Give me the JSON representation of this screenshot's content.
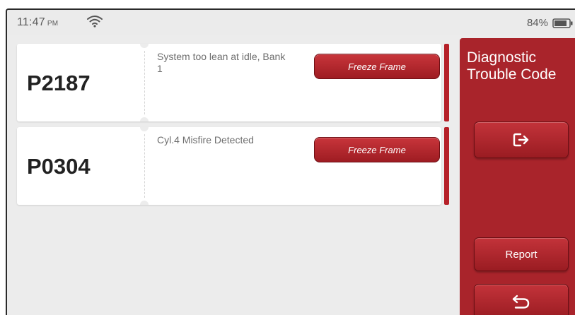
{
  "status_bar": {
    "time": "11:47",
    "ampm": "PM",
    "battery_percent": "84%",
    "icons": [
      "wifi-icon",
      "battery-icon"
    ]
  },
  "dtc_list": [
    {
      "code": "P2187",
      "description": "System too lean at idle, Bank 1",
      "button_label": "Freeze Frame"
    },
    {
      "code": "P0304",
      "description": "Cyl.4 Misfire Detected",
      "button_label": "Freeze Frame"
    }
  ],
  "side_panel": {
    "title": "Diagnostic Trouble Code",
    "exit_icon": "exit-icon",
    "report_label": "Report",
    "back_icon": "back-arrow-icon"
  },
  "colors": {
    "accent_red": "#a9242b",
    "button_red": "#b52028",
    "background": "#ececec",
    "card": "#ffffff"
  }
}
